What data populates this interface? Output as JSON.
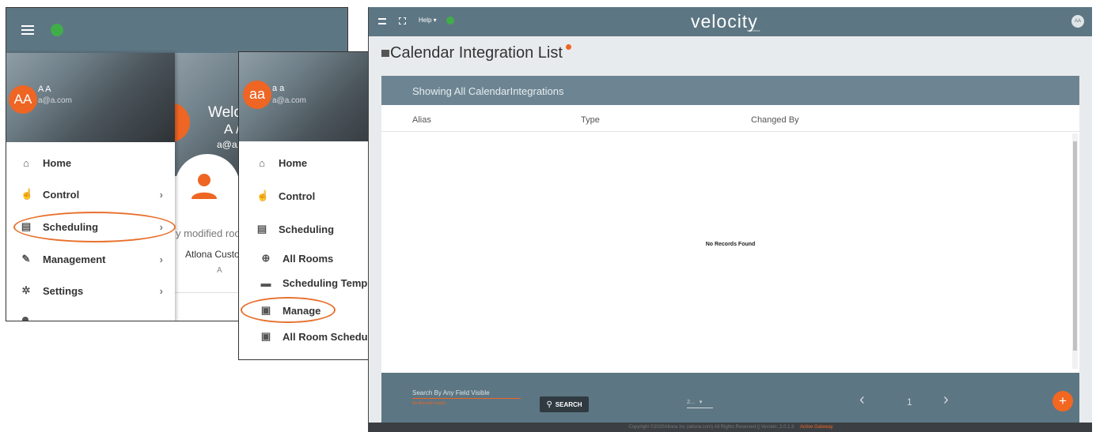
{
  "panel_a": {
    "user_initials": "AA",
    "user_name": "A A",
    "user_email": "a@a.com",
    "welcome_text": "Welc",
    "welcome_name": "A /",
    "welcome_email": "a@a.c",
    "modified_text": "y modified room",
    "org_name": "Atlona Custo",
    "org_initial": "A",
    "menu": [
      {
        "label": "Home",
        "icon": "⌂"
      },
      {
        "label": "Control",
        "icon": "☝"
      },
      {
        "label": "Scheduling",
        "icon": "▤"
      },
      {
        "label": "Management",
        "icon": "✎"
      },
      {
        "label": "Settings",
        "icon": "✲"
      }
    ],
    "chevron": "›"
  },
  "panel_b": {
    "user_initials": "aa",
    "user_name": "a a",
    "user_email": "a@a.com",
    "menu": [
      {
        "label": "Home",
        "icon": "⌂"
      },
      {
        "label": "Control",
        "icon": "☝"
      },
      {
        "label": "Scheduling",
        "icon": "▤"
      },
      {
        "label": "All Rooms",
        "icon": "⊕"
      },
      {
        "label": "Scheduling Templates",
        "icon": "▬"
      },
      {
        "label": "Manage",
        "icon": "▣"
      },
      {
        "label": "All Room Schedule",
        "icon": "▣"
      }
    ],
    "chevron": "›"
  },
  "panel_c": {
    "help_label": "Help ▾",
    "brand": "velocity",
    "brand_sub": "by Atlona",
    "user_initials": "AA",
    "page_title": "Calendar Integration List",
    "grid_title": "Showing All CalendarIntegrations",
    "columns": [
      "Alias",
      "Type",
      "Changed By"
    ],
    "empty_text": "No Records Found",
    "search_placeholder": "Search By Any Field Visible",
    "search_error": "No Records Found",
    "search_button": "SEARCH",
    "page_size": "2...",
    "page_number": "1",
    "prev": "‹",
    "next": "›",
    "fab": "+",
    "copyright": "Copyright ©2020Atlona Inc (atlona.com) All Rights Reserved || Version: 2.0.1.3",
    "gateway_label": "Active Gateway"
  },
  "colors": {
    "header": "#5d7683",
    "accent": "#ee6524",
    "grid_header": "#6d8592",
    "globe": "#3fae49"
  }
}
